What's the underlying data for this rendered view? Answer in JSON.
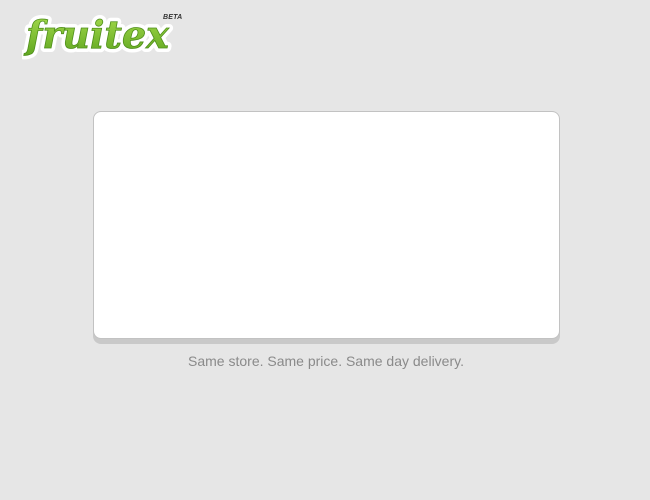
{
  "header": {
    "logo_text": "fruitex",
    "logo_badge": "BETA",
    "brand_green": "#7cc430",
    "brand_dark_green": "#4e8f1a"
  },
  "main": {
    "card_content": "",
    "tagline": "Same store. Same price. Same day delivery."
  },
  "colors": {
    "background": "#e6e6e6",
    "card": "#ffffff",
    "tagline": "#8a8a8a"
  }
}
